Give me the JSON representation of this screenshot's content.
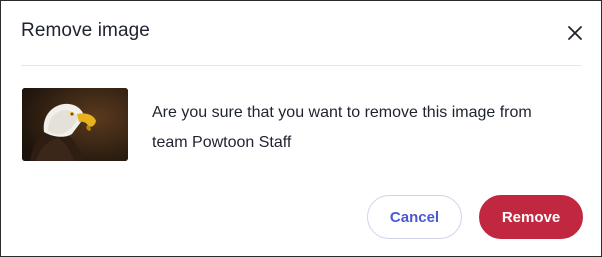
{
  "dialog": {
    "title": "Remove image",
    "close_icon": "close-icon",
    "message_line1": "Are you sure that you want to remove this image from",
    "message_line2": "team Powtoon Staff",
    "image_subject": "bald-eagle-photo",
    "buttons": {
      "cancel_label": "Cancel",
      "remove_label": "Remove"
    },
    "colors": {
      "primary_danger": "#c1273f",
      "link_blue": "#4b58d6",
      "text": "#1f2330"
    }
  }
}
